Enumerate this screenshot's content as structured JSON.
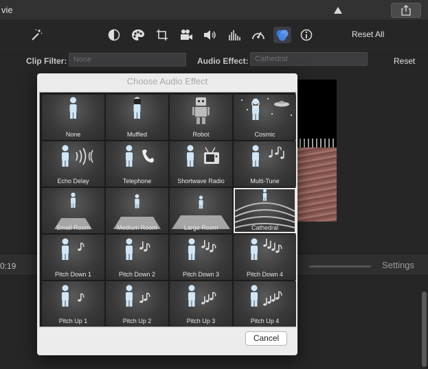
{
  "window": {
    "title": "vie"
  },
  "toolbar": {
    "icons": [
      "magic-wand-icon",
      "color-balance-icon",
      "palette-icon",
      "crop-icon",
      "video-camera-icon",
      "speaker-icon",
      "equalizer-icon",
      "speedometer-icon",
      "filter-circles-icon",
      "info-icon"
    ],
    "reset_all": "Reset All"
  },
  "filters": {
    "clip_filter_label": "Clip Filter:",
    "clip_filter_value": "None",
    "audio_effect_label": "Audio Effect:",
    "audio_effect_value": "Cathedral",
    "reset": "Reset"
  },
  "timeline": {
    "timecode": "0:19",
    "settings": "Settings"
  },
  "dialog": {
    "title": "Choose Audio Effect",
    "selected": "Cathedral",
    "cancel": "Cancel",
    "effects": [
      {
        "label": "None",
        "icon": "person-icon"
      },
      {
        "label": "Muffled",
        "icon": "muffled-person-icon"
      },
      {
        "label": "Robot",
        "icon": "robot-icon"
      },
      {
        "label": "Cosmic",
        "icon": "astronaut-ufo-icon"
      },
      {
        "label": "Echo Delay",
        "icon": "echo-waves-icon"
      },
      {
        "label": "Telephone",
        "icon": "telephone-icon"
      },
      {
        "label": "Shortwave Radio",
        "icon": "tv-radio-icon"
      },
      {
        "label": "Multi-Tune",
        "icon": "music-notes-icon"
      },
      {
        "label": "Small Room",
        "icon": "small-room-icon"
      },
      {
        "label": "Medium Room",
        "icon": "medium-room-icon"
      },
      {
        "label": "Large Room",
        "icon": "large-room-icon"
      },
      {
        "label": "Cathedral",
        "icon": "cathedral-icon"
      },
      {
        "label": "Pitch Down 1",
        "icon": "pitch-down-1-icon"
      },
      {
        "label": "Pitch Down 2",
        "icon": "pitch-down-2-icon"
      },
      {
        "label": "Pitch Down 3",
        "icon": "pitch-down-3-icon"
      },
      {
        "label": "Pitch Down 4",
        "icon": "pitch-down-4-icon"
      },
      {
        "label": "Pitch Up 1",
        "icon": "pitch-up-1-icon"
      },
      {
        "label": "Pitch Up 2",
        "icon": "pitch-up-2-icon"
      },
      {
        "label": "Pitch Up 3",
        "icon": "pitch-up-3-icon"
      },
      {
        "label": "Pitch Up 4",
        "icon": "pitch-up-4-icon"
      }
    ]
  },
  "colors": {
    "accent": "#4a7fd8",
    "person": "#cfe6f7"
  }
}
